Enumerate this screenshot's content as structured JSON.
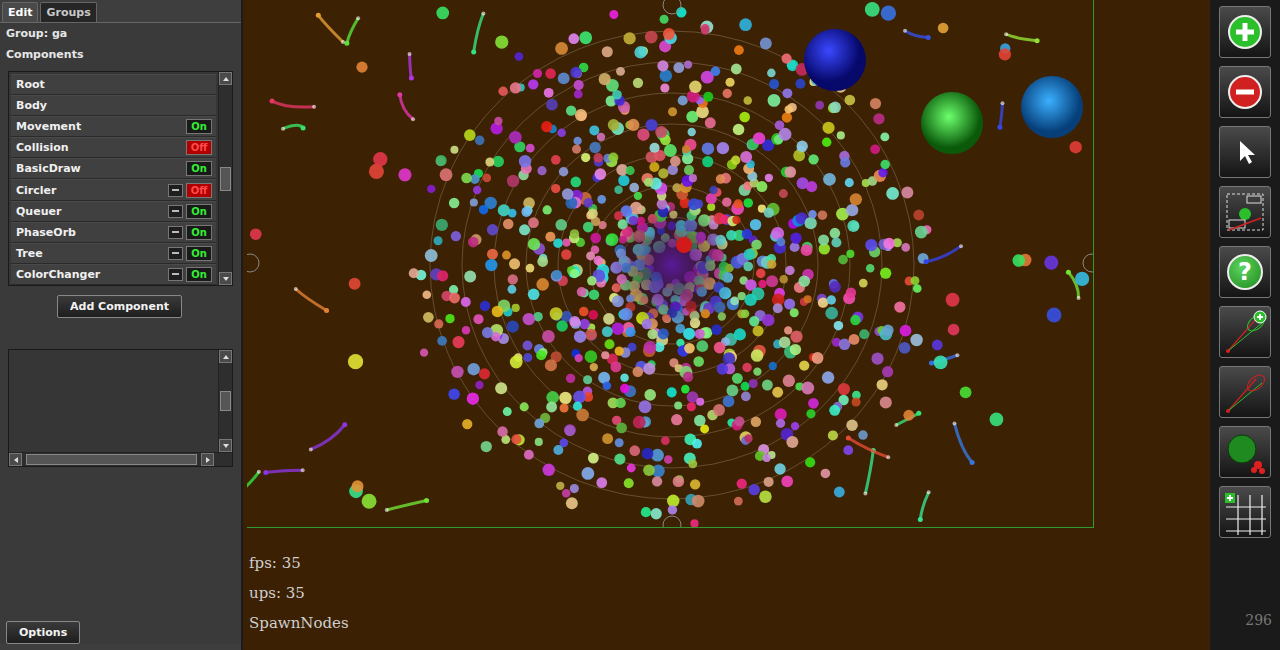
{
  "tabs": [
    {
      "label": "Edit",
      "selected": true
    },
    {
      "label": "Groups",
      "selected": false
    }
  ],
  "group": "Group: ga",
  "components_title": "Components",
  "components": [
    {
      "name": "Root",
      "kind": "label"
    },
    {
      "name": "Body",
      "kind": "label"
    },
    {
      "name": "Movement",
      "kind": "toggle",
      "removable": false,
      "on": true,
      "state": "On"
    },
    {
      "name": "Collision",
      "kind": "toggle",
      "removable": false,
      "on": false,
      "state": "Off"
    },
    {
      "name": "BasicDraw",
      "kind": "toggle",
      "removable": false,
      "on": true,
      "state": "On"
    },
    {
      "name": "Circler",
      "kind": "toggle",
      "removable": true,
      "on": false,
      "state": "Off"
    },
    {
      "name": "Queuer",
      "kind": "toggle",
      "removable": true,
      "on": true,
      "state": "On"
    },
    {
      "name": "PhaseOrb",
      "kind": "toggle",
      "removable": true,
      "on": true,
      "state": "On"
    },
    {
      "name": "Tree",
      "kind": "toggle",
      "removable": true,
      "on": true,
      "state": "On"
    },
    {
      "name": "ColorChanger",
      "kind": "toggle",
      "removable": true,
      "on": true,
      "state": "On"
    }
  ],
  "add_component": "Add Component",
  "options": "Options",
  "stats": [
    "fps: 35",
    "ups: 35",
    "SpawnNodes"
  ],
  "help_glyph": "?",
  "counter": "296"
}
